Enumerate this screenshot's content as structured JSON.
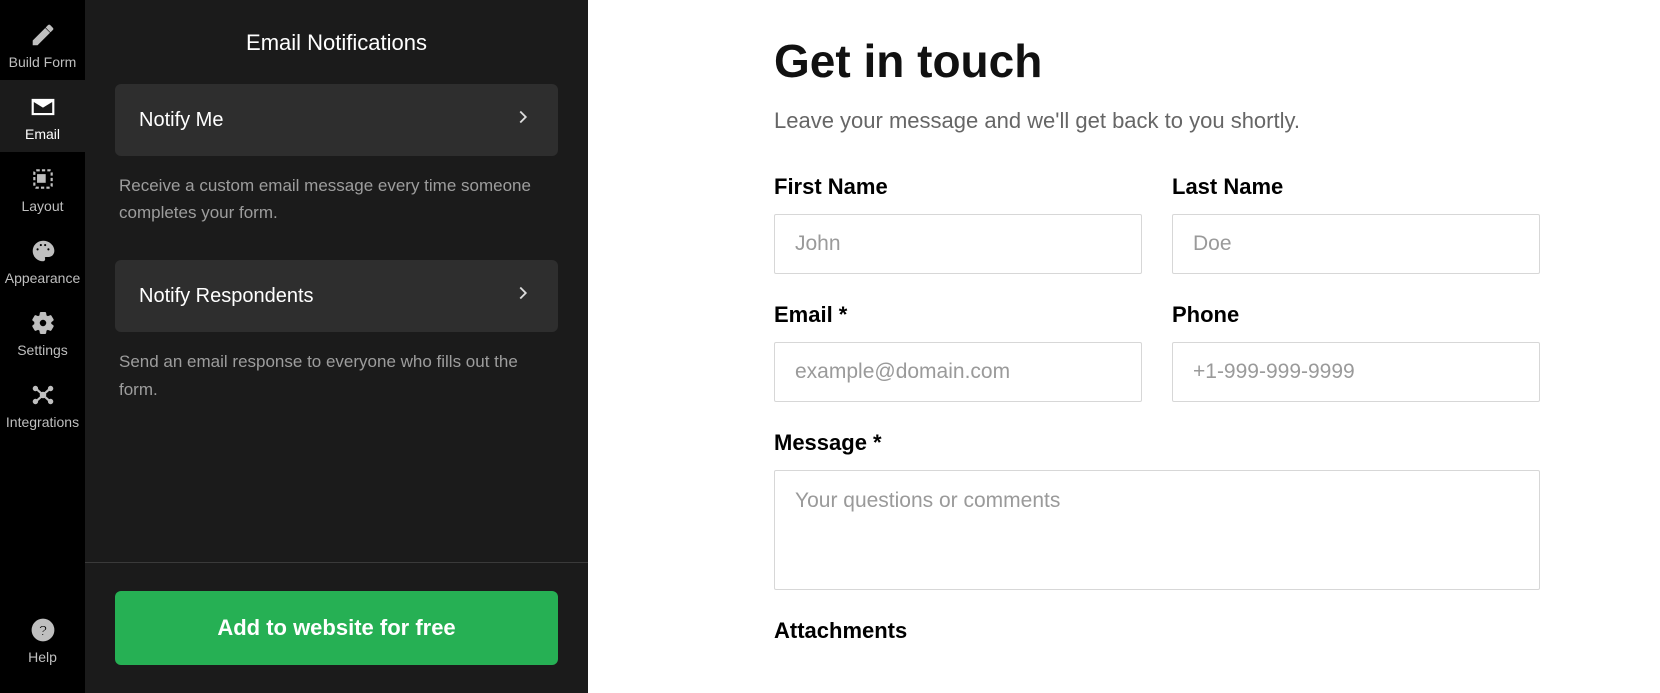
{
  "rail": {
    "items": [
      {
        "label": "Build Form"
      },
      {
        "label": "Email"
      },
      {
        "label": "Layout"
      },
      {
        "label": "Appearance"
      },
      {
        "label": "Settings"
      },
      {
        "label": "Integrations"
      }
    ],
    "help_label": "Help"
  },
  "panel": {
    "title": "Email Notifications",
    "options": [
      {
        "title": "Notify Me",
        "desc": "Receive a custom email message every time someone completes your form."
      },
      {
        "title": "Notify Respondents",
        "desc": "Send an email response to everyone who fills out the form."
      }
    ],
    "cta": "Add to website for free"
  },
  "form": {
    "title": "Get in touch",
    "subtitle": "Leave your message and we'll get back to you shortly.",
    "fields": {
      "first_name": {
        "label": "First Name",
        "placeholder": "John"
      },
      "last_name": {
        "label": "Last Name",
        "placeholder": "Doe"
      },
      "email": {
        "label": "Email *",
        "placeholder": "example@domain.com"
      },
      "phone": {
        "label": "Phone",
        "placeholder": "+1-999-999-9999"
      },
      "message": {
        "label": "Message *",
        "placeholder": "Your questions or comments"
      },
      "attachments": {
        "label": "Attachments"
      }
    }
  }
}
